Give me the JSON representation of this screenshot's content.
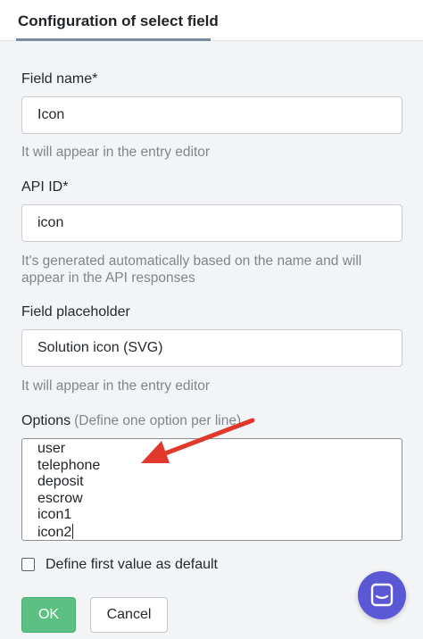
{
  "tabs": [
    {
      "label": "Configuration of select field"
    }
  ],
  "field_name": {
    "label": "Field name*",
    "value": "Icon",
    "help": "It will appear in the entry editor"
  },
  "api_id": {
    "label": "API ID*",
    "value": "icon",
    "help": "It's generated automatically based on the name and will appear in the API responses"
  },
  "field_placeholder": {
    "label": "Field placeholder",
    "value": "Solution icon (SVG)",
    "help": "It will appear in the entry editor"
  },
  "options": {
    "label": "Options",
    "hint": "(Define one option per line)",
    "lines": [
      "user",
      "telephone",
      "deposit",
      "escrow",
      "icon1",
      "icon2"
    ]
  },
  "default_checkbox": {
    "label": "Define first value as default",
    "checked": false
  },
  "buttons": {
    "ok": "OK",
    "cancel": "Cancel"
  },
  "annotation": {
    "color": "#e0382b"
  },
  "colors": {
    "accent": "#5bc082",
    "chat": "#5b58d6"
  },
  "chat_widget": {
    "icon": "chat-icon"
  }
}
